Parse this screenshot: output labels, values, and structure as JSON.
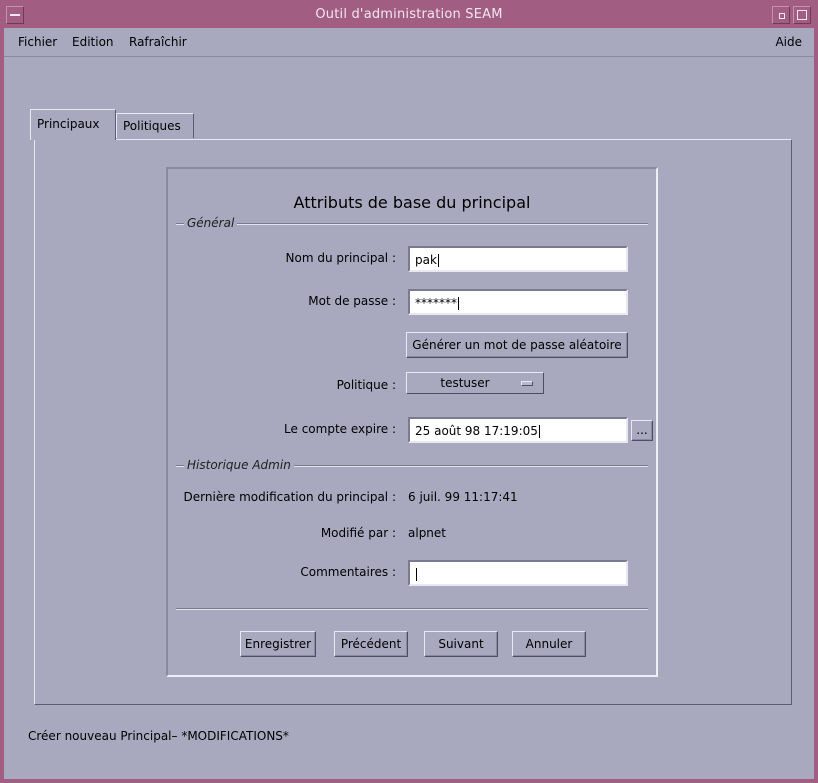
{
  "window": {
    "title": "Outil d'administration SEAM"
  },
  "menubar": {
    "file": "Fichier",
    "edit": "Edition",
    "refresh": "Rafraîchir",
    "help": "Aide"
  },
  "tabs": [
    {
      "label": "Principaux"
    },
    {
      "label": "Politiques"
    }
  ],
  "form": {
    "title": "Attributs de base du principal",
    "general_section": "Général",
    "principal_name_label": "Nom du principal :",
    "principal_name_value": "pak",
    "password_label": "Mot de passe :",
    "password_value": "*******",
    "generate_password_button": "Générer un mot de passe aléatoire",
    "policy_label": "Politique :",
    "policy_value": "testuser",
    "account_expires_label": "Le compte expire :",
    "account_expires_value": "25 août 98 17:19:05",
    "date_picker_button": "...",
    "admin_history_section": "Historique Admin",
    "last_modified_label": "Dernière modification du principal :",
    "last_modified_value": "6 juil. 99 11:17:41",
    "modified_by_label": "Modifié par :",
    "modified_by_value": "alpnet",
    "comments_label": "Commentaires :",
    "comments_value": ""
  },
  "buttons": {
    "save": "Enregistrer",
    "previous": "Précédent",
    "next": "Suivant",
    "cancel": "Annuler"
  },
  "status_bar": {
    "text": "Créer nouveau Principal– *MODIFICATIONS*"
  },
  "colors": {
    "frame": "#a15d82",
    "background": "#a8a8bf"
  }
}
